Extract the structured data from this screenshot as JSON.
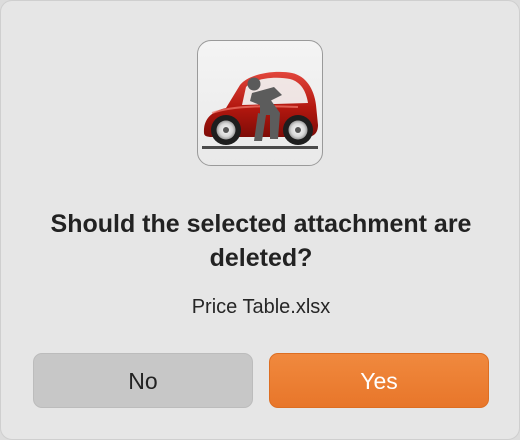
{
  "dialog": {
    "title": "Should the selected attachment are deleted?",
    "filename": "Price Table.xlsx",
    "icon": "car-with-person-icon",
    "buttons": {
      "no_label": "No",
      "yes_label": "Yes"
    },
    "colors": {
      "primary_button": "#ea7a2e",
      "secondary_button": "#c7c7c7",
      "background": "#e6e6e6"
    }
  }
}
